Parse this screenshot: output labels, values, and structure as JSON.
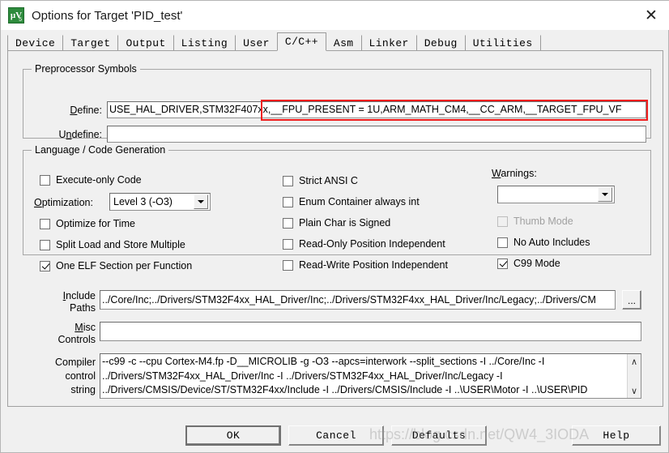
{
  "window": {
    "title": "Options for Target 'PID_test'",
    "icon": "uvision-icon",
    "close_label": "✕"
  },
  "tabs": [
    {
      "label": "Device",
      "active": false
    },
    {
      "label": "Target",
      "active": false
    },
    {
      "label": "Output",
      "active": false
    },
    {
      "label": "Listing",
      "active": false
    },
    {
      "label": "User",
      "active": false
    },
    {
      "label": "C/C++",
      "active": true
    },
    {
      "label": "Asm",
      "active": false
    },
    {
      "label": "Linker",
      "active": false
    },
    {
      "label": "Debug",
      "active": false
    },
    {
      "label": "Utilities",
      "active": false
    }
  ],
  "preprocessor": {
    "legend": "Preprocessor Symbols",
    "define_label": "Define:",
    "define_value": "USE_HAL_DRIVER,STM32F407xx,__FPU_PRESENT = 1U,ARM_MATH_CM4,__CC_ARM,__TARGET_FPU_VF",
    "undefine_label": "Undefine:",
    "undefine_value": "",
    "highlight_color": "#ef1c1c"
  },
  "language": {
    "legend": "Language / Code Generation",
    "col1": [
      {
        "label": "Execute-only Code",
        "checked": false,
        "enabled": true
      },
      {
        "label": "Optimize for Time",
        "checked": false,
        "enabled": true
      },
      {
        "label": "Split Load and Store Multiple",
        "checked": false,
        "enabled": true
      },
      {
        "label": "One ELF Section per Function",
        "checked": true,
        "enabled": true
      }
    ],
    "optimization_label": "Optimization:",
    "optimization_value": "Level 3 (-O3)",
    "col2": [
      {
        "label": "Strict ANSI C",
        "checked": false,
        "enabled": true
      },
      {
        "label": "Enum Container always int",
        "checked": false,
        "enabled": true
      },
      {
        "label": "Plain Char is Signed",
        "checked": false,
        "enabled": true
      },
      {
        "label": "Read-Only Position Independent",
        "checked": false,
        "enabled": true
      },
      {
        "label": "Read-Write Position Independent",
        "checked": false,
        "enabled": true
      }
    ],
    "warnings_label": "Warnings:",
    "warnings_value": "",
    "col3": [
      {
        "label": "Thumb Mode",
        "checked": false,
        "enabled": false
      },
      {
        "label": "No Auto Includes",
        "checked": false,
        "enabled": true
      },
      {
        "label": "C99 Mode",
        "checked": true,
        "enabled": true
      }
    ]
  },
  "paths": {
    "include_label_line1": "Include",
    "include_label_line2": "Paths",
    "include_value": "../Core/Inc;../Drivers/STM32F4xx_HAL_Driver/Inc;../Drivers/STM32F4xx_HAL_Driver/Inc/Legacy;../Drivers/CM",
    "browse_label": "...",
    "misc_label_line1": "Misc",
    "misc_label_line2": "Controls",
    "misc_value": ""
  },
  "compiler": {
    "label_line1": "Compiler",
    "label_line2": "control",
    "label_line3": "string",
    "value": "--c99 -c --cpu Cortex-M4.fp -D__MICROLIB -g -O3 --apcs=interwork --split_sections -I ../Core/Inc -I\n../Drivers/STM32F4xx_HAL_Driver/Inc -I ../Drivers/STM32F4xx_HAL_Driver/Inc/Legacy -I\n../Drivers/CMSIS/Device/ST/STM32F4xx/Include -I ../Drivers/CMSIS/Include -I ..\\USER\\Motor -I ..\\USER\\PID",
    "scroll_up": "∧",
    "scroll_down": "∨"
  },
  "buttons": {
    "ok": "OK",
    "cancel": "Cancel",
    "defaults": "Defaults",
    "help": "Help"
  },
  "watermark": "https://blog.csdn.net/QW4_3IODA"
}
